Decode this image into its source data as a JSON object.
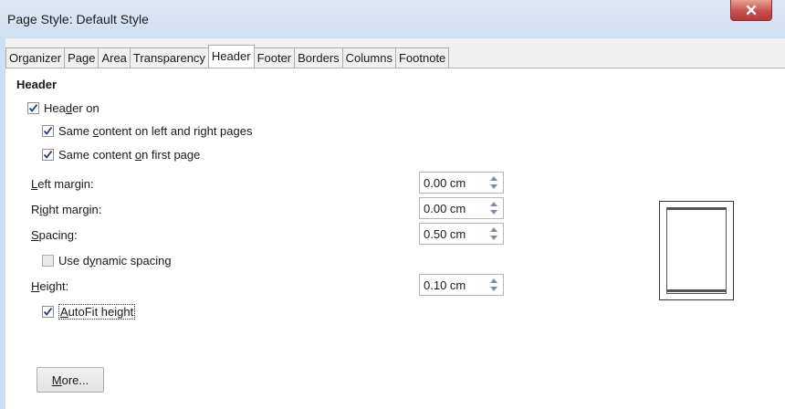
{
  "window": {
    "title": "Page Style: Default Style"
  },
  "tabs": [
    {
      "label": "Organizer",
      "active": false
    },
    {
      "label": "Page",
      "active": false
    },
    {
      "label": "Area",
      "active": false
    },
    {
      "label": "Transparency",
      "active": false
    },
    {
      "label": "Header",
      "active": true
    },
    {
      "label": "Footer",
      "active": false
    },
    {
      "label": "Borders",
      "active": false
    },
    {
      "label": "Columns",
      "active": false
    },
    {
      "label": "Footnote",
      "active": false
    }
  ],
  "header_section": {
    "title": "Header",
    "header_on": {
      "pre": "Hea",
      "u": "d",
      "post": "er on",
      "checked": true
    },
    "same_left_right": {
      "pre": "Same ",
      "u": "c",
      "post": "ontent on left and right pages",
      "checked": true
    },
    "same_first_page": {
      "pre": "Same content ",
      "u": "o",
      "post": "n first page",
      "checked": true
    },
    "left_margin": {
      "u": "L",
      "post": "eft margin:",
      "value": "0.00 cm"
    },
    "right_margin": {
      "pre": "R",
      "u": "i",
      "post": "ght margin:",
      "value": "0.00 cm"
    },
    "spacing": {
      "u": "S",
      "post": "pacing:",
      "value": "0.50 cm"
    },
    "dynamic_spacing": {
      "pre": "Use d",
      "u": "y",
      "post": "namic spacing",
      "checked": false
    },
    "height": {
      "u": "H",
      "post": "eight:",
      "value": "0.10 cm"
    },
    "autofit": {
      "u": "A",
      "post": "utoFit height",
      "checked": true
    },
    "more_button": {
      "u": "M",
      "post": "ore..."
    }
  },
  "colors": {
    "titlebar": "#cfdff2",
    "close": "#c75050",
    "check": "#1f3f7a"
  }
}
